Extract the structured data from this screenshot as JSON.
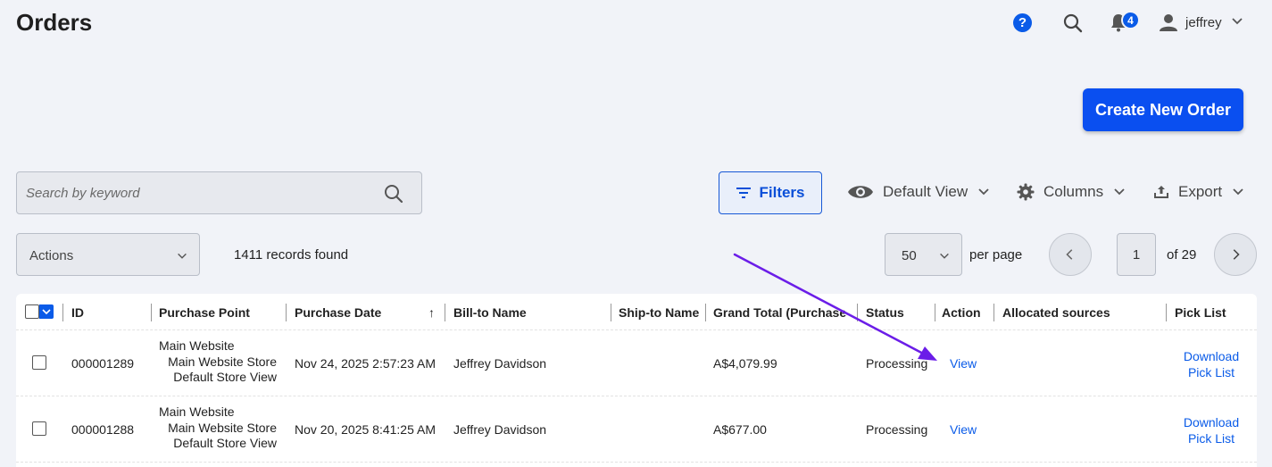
{
  "header": {
    "title": "Orders",
    "notification_count": "4",
    "user_name": "jeffrey"
  },
  "toolbar": {
    "create_label": "Create New Order",
    "search_placeholder": "Search by keyword",
    "filters_label": "Filters",
    "view_label": "Default View",
    "columns_label": "Columns",
    "export_label": "Export"
  },
  "grid_controls": {
    "actions_label": "Actions",
    "records_found": "1411 records found",
    "per_page_value": "50",
    "per_page_label": "per page",
    "current_page": "1",
    "total_pages_label": "of 29"
  },
  "table": {
    "columns": {
      "id": "ID",
      "purchase_point": "Purchase Point",
      "purchase_date": "Purchase Date",
      "sort_indicator": "↑",
      "bill_to": "Bill-to Name",
      "ship_to": "Ship-to Name",
      "grand_total": "Grand Total (Purchased)",
      "status": "Status",
      "action": "Action",
      "allocated_sources": "Allocated sources",
      "pick_list": "Pick List"
    },
    "rows": [
      {
        "id": "000001289",
        "pp_website": "Main Website",
        "pp_store": "Main Website Store",
        "pp_view": "Default Store View",
        "purchase_date": "Nov 24, 2025 2:57:23 AM",
        "bill_to": "Jeffrey Davidson",
        "ship_to": "",
        "grand_total": "A$4,079.99",
        "status": "Processing",
        "action": "View",
        "pick_list_1": "Download",
        "pick_list_2": "Pick List"
      },
      {
        "id": "000001288",
        "pp_website": "Main Website",
        "pp_store": "Main Website Store",
        "pp_view": "Default Store View",
        "purchase_date": "Nov 20, 2025 8:41:25 AM",
        "bill_to": "Jeffrey Davidson",
        "ship_to": "",
        "grand_total": "A$677.00",
        "status": "Processing",
        "action": "View",
        "pick_list_1": "Download",
        "pick_list_2": "Pick List"
      }
    ]
  },
  "colors": {
    "accent": "#0a4ff0",
    "annotation_arrow": "#6b1de8"
  }
}
